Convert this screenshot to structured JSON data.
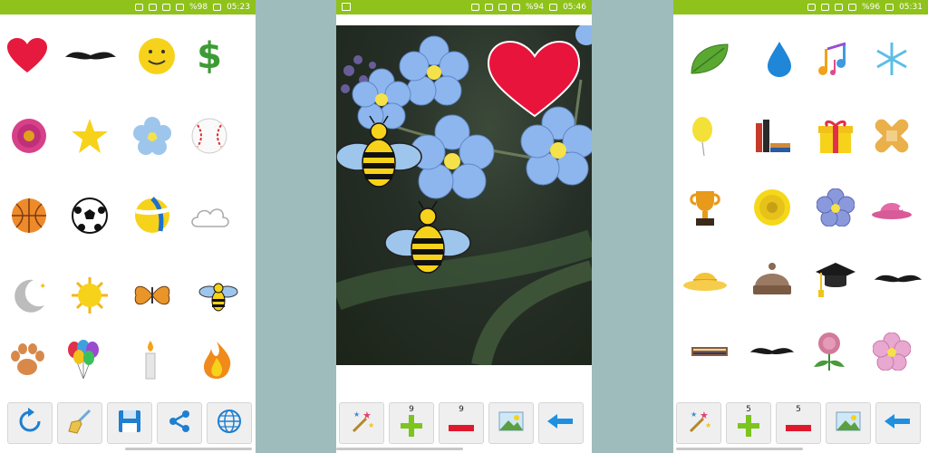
{
  "screens": [
    {
      "status_text": "%98",
      "time": "05:23"
    },
    {
      "status_text": "%94",
      "time": "05:46"
    },
    {
      "status_text": "%96",
      "time": "05:31"
    }
  ],
  "screen1": {
    "stickers": [
      "heart-sticker",
      "mustache-sticker",
      "smiley-sticker",
      "dollar-sticker",
      "pink-flower-sticker",
      "star-sticker",
      "blue-flower-sticker",
      "baseball-sticker",
      "basketball-sticker",
      "soccer-ball-sticker",
      "volleyball-sticker",
      "cloud-sticker",
      "moon-sticker",
      "sun-sticker",
      "butterfly-sticker",
      "bee-sticker",
      "paw-sticker",
      "balloons-sticker",
      "candle-sticker",
      "flame-sticker"
    ],
    "dollar_glyph": "$",
    "toolbar": [
      "rotate-icon",
      "broom-icon",
      "save-icon",
      "share-icon",
      "globe-icon"
    ]
  },
  "screen2": {
    "toolbar": [
      "magic-wand-icon",
      "plus-icon",
      "minus-icon",
      "image-icon",
      "back-arrow-icon"
    ],
    "plus_count": "9",
    "minus_count": "9"
  },
  "screen3": {
    "stickers": [
      "leaf-sticker",
      "water-drop-sticker",
      "music-notes-sticker",
      "snowflake-sticker",
      "yellow-balloon-sticker",
      "books-sticker",
      "gift-sticker",
      "bandage-sticker",
      "trophy-sticker",
      "yellow-flower-sticker",
      "purple-flower-sticker",
      "pink-hat-sticker",
      "straw-hat-sticker",
      "beanie-sticker",
      "graduation-cap-sticker",
      "mustache-sticker",
      "book-sticker",
      "mustache-sticker",
      "clover-flower-sticker",
      "pink-blossom-sticker"
    ],
    "toolbar": [
      "magic-wand-icon",
      "plus-icon",
      "minus-icon",
      "image-icon",
      "back-arrow-icon"
    ],
    "plus_count": "5",
    "minus_count": "5"
  },
  "colors": {
    "status_bar": "#8fc21a",
    "gap": "#9fbcbc",
    "heart": "#e51a3e",
    "accent_green": "#7cc41f",
    "minus_red": "#e0182d",
    "arrow_blue": "#1f8fe0"
  }
}
